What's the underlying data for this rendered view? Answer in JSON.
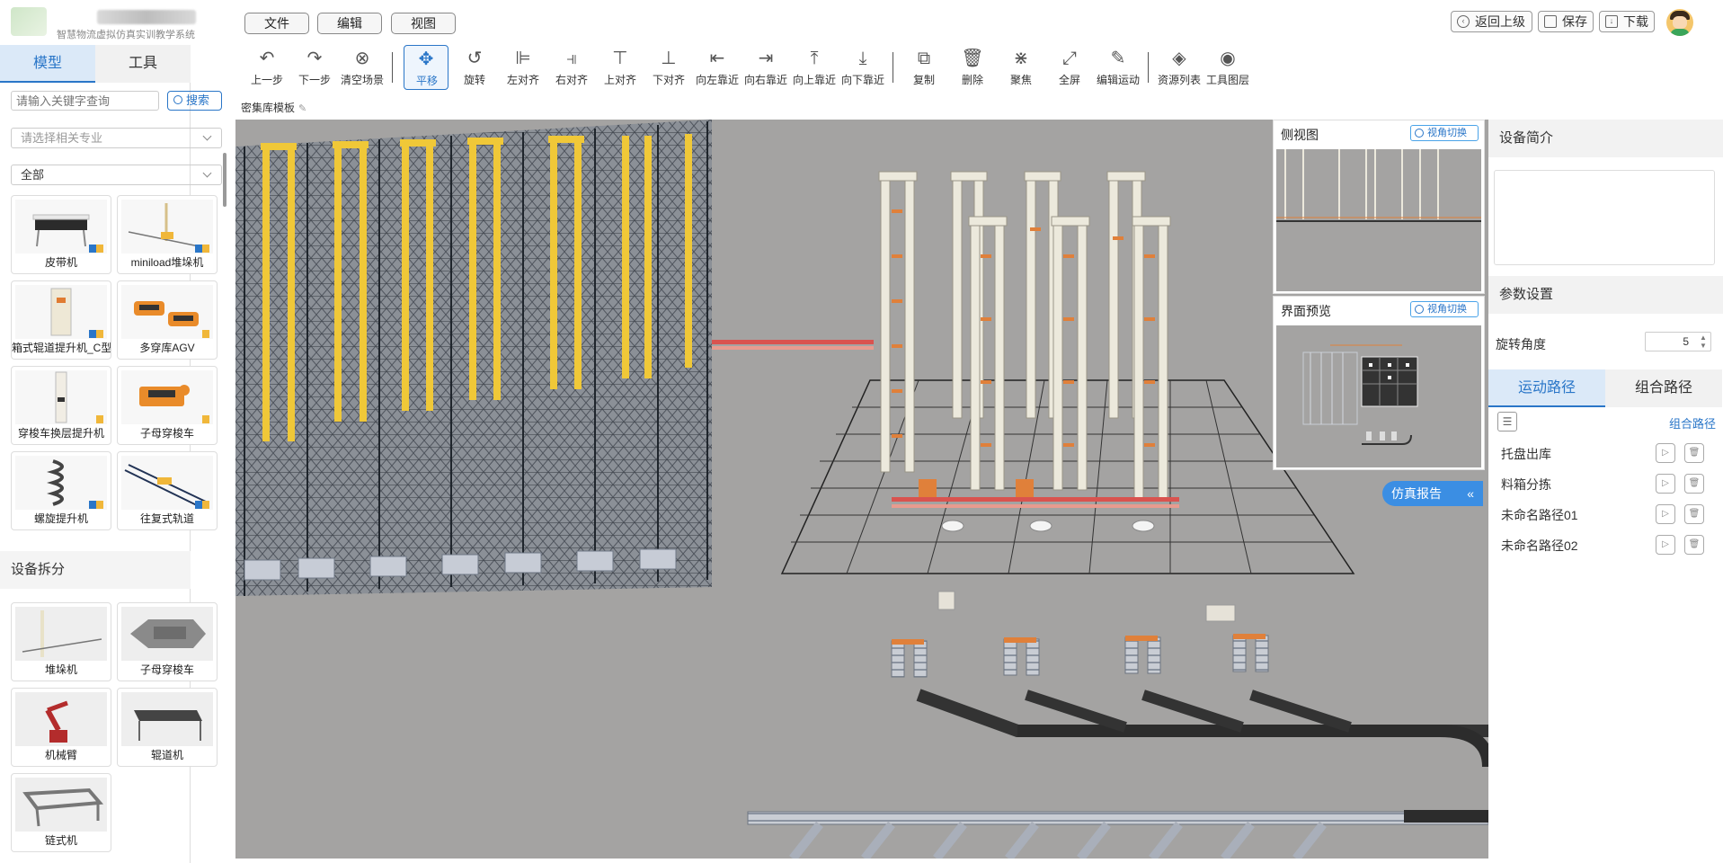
{
  "app": {
    "subtitle": "智慧物流虚拟仿真实训教学系统"
  },
  "menu": {
    "file": "文件",
    "edit": "编辑",
    "view": "视图"
  },
  "actions": {
    "back": "返回上级",
    "save": "保存",
    "download": "下载"
  },
  "left_tabs": {
    "model": "模型",
    "tools": "工具"
  },
  "search": {
    "placeholder": "请输入关键字查询",
    "button": "搜索"
  },
  "filters": {
    "major_placeholder": "请选择相关专业",
    "category": "全部"
  },
  "models": [
    {
      "label": "皮带机"
    },
    {
      "label": "miniload堆垛机"
    },
    {
      "label": "箱式辊道提升机_C型"
    },
    {
      "label": "多穿库AGV"
    },
    {
      "label": "穿梭车换层提升机"
    },
    {
      "label": "子母穿梭车"
    },
    {
      "label": "螺旋提升机"
    },
    {
      "label": "往复式轨道"
    }
  ],
  "split_section": {
    "title": "设备拆分",
    "items": [
      {
        "label": "堆垛机"
      },
      {
        "label": "子母穿梭车"
      },
      {
        "label": "机械臂"
      },
      {
        "label": "辊道机"
      },
      {
        "label": "链式机"
      }
    ]
  },
  "toolbar": [
    {
      "label": "上一步",
      "icon": "undo-icon"
    },
    {
      "label": "下一步",
      "icon": "redo-icon"
    },
    {
      "label": "清空场景",
      "icon": "clear-icon"
    },
    {
      "label": "平移",
      "icon": "move-icon"
    },
    {
      "label": "旋转",
      "icon": "rotate-icon"
    },
    {
      "label": "左对齐",
      "icon": "align-left-icon"
    },
    {
      "label": "右对齐",
      "icon": "align-right-icon"
    },
    {
      "label": "上对齐",
      "icon": "align-top-icon"
    },
    {
      "label": "下对齐",
      "icon": "align-bottom-icon"
    },
    {
      "label": "向左靠近",
      "icon": "snap-left-icon"
    },
    {
      "label": "向右靠近",
      "icon": "snap-right-icon"
    },
    {
      "label": "向上靠近",
      "icon": "snap-up-icon"
    },
    {
      "label": "向下靠近",
      "icon": "snap-down-icon"
    },
    {
      "label": "复制",
      "icon": "copy-icon"
    },
    {
      "label": "删除",
      "icon": "delete-icon"
    },
    {
      "label": "聚焦",
      "icon": "focus-icon"
    },
    {
      "label": "全屏",
      "icon": "fullscreen-icon"
    },
    {
      "label": "编辑运动",
      "icon": "edit-motion-icon"
    },
    {
      "label": "资源列表",
      "icon": "layers-icon"
    },
    {
      "label": "工具图层",
      "icon": "eye-icon"
    }
  ],
  "breadcrumb": "密集库模板",
  "side_view": {
    "title": "侧视图",
    "switch": "视角切换"
  },
  "preview": {
    "title": "界面预览",
    "switch": "视角切换"
  },
  "report_button": "仿真报告",
  "right_panel": {
    "intro_title": "设备简介",
    "params_title": "参数设置",
    "rotation_label": "旋转角度",
    "rotation_value": "5",
    "tab_motion": "运动路径",
    "tab_combo": "组合路径",
    "combo_link": "组合路径",
    "paths": [
      {
        "name": "托盘出库"
      },
      {
        "name": "料箱分拣"
      },
      {
        "name": "未命名路径01"
      },
      {
        "name": "未命名路径02"
      }
    ]
  }
}
